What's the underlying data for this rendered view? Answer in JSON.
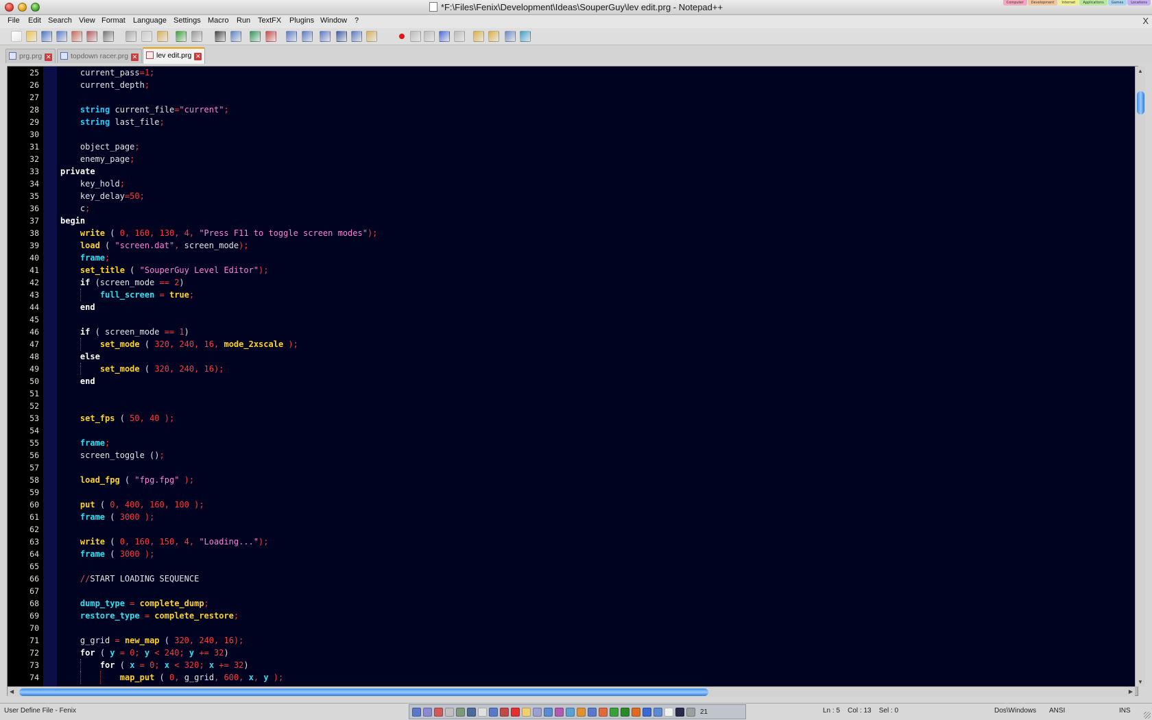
{
  "window": {
    "title": "*F:\\Files\\Fenix\\Development\\Ideas\\SouperGuy\\lev edit.prg - Notepad++",
    "stack_tabs": [
      {
        "label": "Computer",
        "color": "#f7a7bd"
      },
      {
        "label": "Development",
        "color": "#f5c59a"
      },
      {
        "label": "Internet",
        "color": "#f1ef8f"
      },
      {
        "label": "Applications",
        "color": "#b7e79b"
      },
      {
        "label": "Games",
        "color": "#a8d4f2"
      },
      {
        "label": "Locations",
        "color": "#c9aef0"
      }
    ]
  },
  "menu": {
    "items": [
      "File",
      "Edit",
      "Search",
      "View",
      "Format",
      "Language",
      "Settings",
      "Macro",
      "Run",
      "TextFX",
      "Plugins",
      "Window",
      "?"
    ],
    "close": "X"
  },
  "toolbar": {
    "buttons": [
      "new-file",
      "open-file",
      "save",
      "save-all",
      "close",
      "close-all",
      "print",
      "cut",
      "copy",
      "paste",
      "undo",
      "redo",
      "find",
      "replace",
      "zoom-in",
      "zoom-out",
      "sync-vertical",
      "sync-horizontal",
      "word-wrap",
      "show-all-chars",
      "indent-guide",
      "user-language",
      "record-macro",
      "stop-recording",
      "play-macro",
      "run-macro-multiple",
      "save-macro",
      "open-folder",
      "open-in-explorer",
      "console",
      "spell-check"
    ]
  },
  "tabs": [
    {
      "label": "prg.prg",
      "active": false
    },
    {
      "label": "topdown racer.prg",
      "active": false
    },
    {
      "label": "lev edit.prg",
      "active": true
    }
  ],
  "tab_close_glyph": "✕",
  "editor": {
    "lines": [
      {
        "n": "25",
        "indent": 1,
        "tokens": [
          [
            "current_pass",
            "id"
          ],
          [
            "=1;",
            "nu"
          ]
        ]
      },
      {
        "n": "26",
        "indent": 1,
        "tokens": [
          [
            "current_depth",
            "id"
          ],
          [
            ";",
            "op"
          ]
        ]
      },
      {
        "n": "27",
        "indent": 0,
        "tokens": []
      },
      {
        "n": "28",
        "indent": 1,
        "tokens": [
          [
            "string",
            "ty"
          ],
          [
            " current_file",
            "id"
          ],
          [
            "=",
            "op"
          ],
          [
            "\"current\"",
            "st"
          ],
          [
            ";",
            "op"
          ]
        ]
      },
      {
        "n": "29",
        "indent": 1,
        "tokens": [
          [
            "string",
            "ty"
          ],
          [
            " last_file",
            "id"
          ],
          [
            ";",
            "op"
          ]
        ]
      },
      {
        "n": "30",
        "indent": 0,
        "tokens": []
      },
      {
        "n": "31",
        "indent": 1,
        "tokens": [
          [
            "object_page",
            "id"
          ],
          [
            ";",
            "op"
          ]
        ]
      },
      {
        "n": "32",
        "indent": 1,
        "tokens": [
          [
            "enemy_page",
            "id"
          ],
          [
            ";",
            "op"
          ]
        ]
      },
      {
        "n": "33",
        "indent": 0,
        "tokens": [
          [
            "private",
            "kw"
          ]
        ]
      },
      {
        "n": "34",
        "indent": 1,
        "tokens": [
          [
            "key_hold",
            "id"
          ],
          [
            ";",
            "op"
          ]
        ]
      },
      {
        "n": "35",
        "indent": 1,
        "tokens": [
          [
            "key_delay",
            "id"
          ],
          [
            "=50;",
            "nu"
          ]
        ]
      },
      {
        "n": "36",
        "indent": 1,
        "tokens": [
          [
            "c",
            "id"
          ],
          [
            ";",
            "op"
          ]
        ]
      },
      {
        "n": "37",
        "indent": 0,
        "tokens": [
          [
            "begin",
            "kw"
          ]
        ]
      },
      {
        "n": "38",
        "indent": 1,
        "tokens": [
          [
            "write",
            "fn"
          ],
          [
            " ( ",
            "id"
          ],
          [
            "0, 160, 130, 4, ",
            "nu"
          ],
          [
            "\"Press F11 to toggle screen modes\"",
            "st"
          ],
          [
            ");",
            "op"
          ]
        ]
      },
      {
        "n": "39",
        "indent": 1,
        "tokens": [
          [
            "load",
            "fn"
          ],
          [
            " ( ",
            "id"
          ],
          [
            "\"screen.dat\"",
            "st"
          ],
          [
            ", ",
            "op"
          ],
          [
            "screen_mode",
            "id"
          ],
          [
            ");",
            "op"
          ]
        ]
      },
      {
        "n": "40",
        "indent": 1,
        "tokens": [
          [
            "frame",
            "bl"
          ],
          [
            ";",
            "op"
          ]
        ]
      },
      {
        "n": "41",
        "indent": 1,
        "tokens": [
          [
            "set_title",
            "fn"
          ],
          [
            " ( ",
            "id"
          ],
          [
            "\"SouperGuy Level Editor\"",
            "st"
          ],
          [
            ");",
            "op"
          ]
        ]
      },
      {
        "n": "42",
        "indent": 1,
        "tokens": [
          [
            "if",
            "kw"
          ],
          [
            " (screen_mode ",
            "id"
          ],
          [
            "== 2",
            "nu"
          ],
          [
            ")",
            "id"
          ]
        ]
      },
      {
        "n": "43",
        "indent": 2,
        "tokens": [
          [
            "full_screen",
            "bl"
          ],
          [
            " = ",
            "op"
          ],
          [
            "true",
            "fn"
          ],
          [
            ";",
            "op"
          ]
        ]
      },
      {
        "n": "44",
        "indent": 1,
        "tokens": [
          [
            "end",
            "kw"
          ]
        ]
      },
      {
        "n": "45",
        "indent": 0,
        "tokens": []
      },
      {
        "n": "46",
        "indent": 1,
        "tokens": [
          [
            "if",
            "kw"
          ],
          [
            " ( screen_mode ",
            "id"
          ],
          [
            "== 1",
            "nu"
          ],
          [
            ")",
            "id"
          ]
        ]
      },
      {
        "n": "47",
        "indent": 2,
        "tokens": [
          [
            "set_mode",
            "fn"
          ],
          [
            " ( ",
            "id"
          ],
          [
            "320, 240, 16, ",
            "nu"
          ],
          [
            "mode_2xscale",
            "fn"
          ],
          [
            " );",
            "op"
          ]
        ]
      },
      {
        "n": "48",
        "indent": 1,
        "tokens": [
          [
            "else",
            "kw"
          ]
        ]
      },
      {
        "n": "49",
        "indent": 2,
        "tokens": [
          [
            "set_mode",
            "fn"
          ],
          [
            " ( ",
            "id"
          ],
          [
            "320, 240, 16",
            "nu"
          ],
          [
            ");",
            "op"
          ]
        ]
      },
      {
        "n": "50",
        "indent": 1,
        "tokens": [
          [
            "end",
            "kw"
          ]
        ]
      },
      {
        "n": "51",
        "indent": 0,
        "tokens": []
      },
      {
        "n": "52",
        "indent": 0,
        "tokens": []
      },
      {
        "n": "53",
        "indent": 1,
        "tokens": [
          [
            "set_fps",
            "fn"
          ],
          [
            " ( ",
            "id"
          ],
          [
            "50, 40",
            "nu"
          ],
          [
            " );",
            "op"
          ]
        ]
      },
      {
        "n": "54",
        "indent": 0,
        "tokens": []
      },
      {
        "n": "55",
        "indent": 1,
        "tokens": [
          [
            "frame",
            "bl"
          ],
          [
            ";",
            "op"
          ]
        ]
      },
      {
        "n": "56",
        "indent": 1,
        "tokens": [
          [
            "screen_toggle ()",
            "id"
          ],
          [
            ";",
            "op"
          ]
        ]
      },
      {
        "n": "57",
        "indent": 0,
        "tokens": []
      },
      {
        "n": "58",
        "indent": 1,
        "tokens": [
          [
            "load_fpg",
            "fn"
          ],
          [
            " ( ",
            "id"
          ],
          [
            "\"fpg.fpg\"",
            "st"
          ],
          [
            " );",
            "op"
          ]
        ]
      },
      {
        "n": "59",
        "indent": 0,
        "tokens": []
      },
      {
        "n": "60",
        "indent": 1,
        "tokens": [
          [
            "put",
            "fn"
          ],
          [
            " ( ",
            "id"
          ],
          [
            "0, 400, 160, 100",
            "nu"
          ],
          [
            " );",
            "op"
          ]
        ]
      },
      {
        "n": "61",
        "indent": 1,
        "tokens": [
          [
            "frame",
            "bl"
          ],
          [
            " ( ",
            "id"
          ],
          [
            "3000",
            "nu"
          ],
          [
            " );",
            "op"
          ]
        ]
      },
      {
        "n": "62",
        "indent": 0,
        "tokens": []
      },
      {
        "n": "63",
        "indent": 1,
        "tokens": [
          [
            "write",
            "fn"
          ],
          [
            " ( ",
            "id"
          ],
          [
            "0, 160, 150, 4, ",
            "nu"
          ],
          [
            "\"Loading...\"",
            "st"
          ],
          [
            ");",
            "op"
          ]
        ]
      },
      {
        "n": "64",
        "indent": 1,
        "tokens": [
          [
            "frame",
            "bl"
          ],
          [
            " ( ",
            "id"
          ],
          [
            "3000",
            "nu"
          ],
          [
            " );",
            "op"
          ]
        ]
      },
      {
        "n": "65",
        "indent": 0,
        "tokens": []
      },
      {
        "n": "66",
        "indent": 1,
        "tokens": [
          [
            "//",
            "cm"
          ],
          [
            "START LOADING SEQUENCE",
            "id"
          ]
        ]
      },
      {
        "n": "67",
        "indent": 0,
        "tokens": []
      },
      {
        "n": "68",
        "indent": 1,
        "tokens": [
          [
            "dump_type",
            "bl"
          ],
          [
            " = ",
            "op"
          ],
          [
            "complete_dump",
            "fn"
          ],
          [
            ";",
            "op"
          ]
        ]
      },
      {
        "n": "69",
        "indent": 1,
        "tokens": [
          [
            "restore_type",
            "bl"
          ],
          [
            " = ",
            "op"
          ],
          [
            "complete_restore",
            "fn"
          ],
          [
            ";",
            "op"
          ]
        ]
      },
      {
        "n": "70",
        "indent": 0,
        "tokens": []
      },
      {
        "n": "71",
        "indent": 1,
        "tokens": [
          [
            "g_grid",
            "id"
          ],
          [
            " = ",
            "op"
          ],
          [
            "new_map",
            "fn"
          ],
          [
            " ( ",
            "id"
          ],
          [
            "320, 240, 16",
            "nu"
          ],
          [
            ");",
            "op"
          ]
        ]
      },
      {
        "n": "72",
        "indent": 1,
        "tokens": [
          [
            "for",
            "kw"
          ],
          [
            " ( ",
            "id"
          ],
          [
            "y",
            "bl"
          ],
          [
            " = 0; ",
            "nu"
          ],
          [
            "y",
            "bl"
          ],
          [
            " < 240; ",
            "nu"
          ],
          [
            "y",
            "bl"
          ],
          [
            " += 32",
            "nu"
          ],
          [
            ")",
            "id"
          ]
        ]
      },
      {
        "n": "73",
        "indent": 2,
        "tokens": [
          [
            "for",
            "kw"
          ],
          [
            " ( ",
            "id"
          ],
          [
            "x",
            "bl"
          ],
          [
            " = 0; ",
            "nu"
          ],
          [
            "x",
            "bl"
          ],
          [
            " < 320; ",
            "nu"
          ],
          [
            "x",
            "bl"
          ],
          [
            " += 32",
            "nu"
          ],
          [
            ")",
            "id"
          ]
        ]
      },
      {
        "n": "74",
        "indent": 3,
        "tokens": [
          [
            "map_put",
            "fn"
          ],
          [
            " ( ",
            "id"
          ],
          [
            "0, ",
            "nu"
          ],
          [
            "g_grid",
            "id"
          ],
          [
            ", 600, ",
            "nu"
          ],
          [
            "x",
            "bl"
          ],
          [
            ", ",
            "op"
          ],
          [
            "y",
            "bl"
          ],
          [
            " );",
            "op"
          ]
        ]
      }
    ]
  },
  "scrollbar": {
    "vertical_up": "▲",
    "vertical_down": "▼",
    "horizontal_left": "◀",
    "horizontal_right": "▶"
  },
  "statusbar": {
    "language": "User Define File - Fenix",
    "tray_text": "21",
    "position": "Ln : 5    Col : 13    Sel : 0",
    "eol": "Dos\\Windows",
    "encoding": "ANSI",
    "mode": "INS"
  },
  "colors": {
    "editor_bg": "#000320",
    "gutter_bg": "#000000",
    "keyword": "#ffffff",
    "function": "#ffd21e",
    "builtin": "#2fe0f0",
    "string": "#ff80d8",
    "number": "#ff3a3a"
  }
}
